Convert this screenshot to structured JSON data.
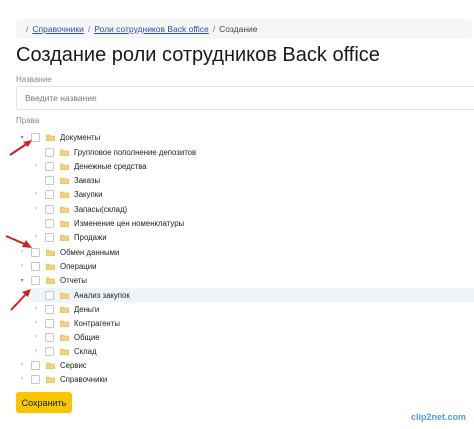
{
  "breadcrumb": {
    "items": [
      "Справочники",
      "Роли сотрудников Back office"
    ],
    "current": "Создание"
  },
  "page": {
    "title": "Создание роли сотрудников Back office"
  },
  "form": {
    "name_label": "Название",
    "name_placeholder": "Введите название",
    "name_value": "",
    "rights_label": "Права"
  },
  "tree": [
    {
      "label": "Документы",
      "arrow": "expanded"
    },
    {
      "label": "Групповое пополнение депозитов",
      "arrow": "none"
    },
    {
      "label": "Денежные средства",
      "arrow": "collapsed"
    },
    {
      "label": "Заказы",
      "arrow": "none"
    },
    {
      "label": "Закупки",
      "arrow": "collapsed"
    },
    {
      "label": "Запасы(склад)",
      "arrow": "collapsed"
    },
    {
      "label": "Изменение цен номенклатуры",
      "arrow": "none"
    },
    {
      "label": "Продажи",
      "arrow": "collapsed"
    },
    {
      "label": "Обмен данными",
      "arrow": "collapsed"
    },
    {
      "label": "Операции",
      "arrow": "collapsed"
    },
    {
      "label": "Отчеты",
      "arrow": "expanded"
    },
    {
      "label": "Анализ закупок",
      "arrow": "none"
    },
    {
      "label": "Деньги",
      "arrow": "collapsed"
    },
    {
      "label": "Контрагенты",
      "arrow": "collapsed"
    },
    {
      "label": "Общие",
      "arrow": "collapsed"
    },
    {
      "label": "Склад",
      "arrow": "collapsed"
    },
    {
      "label": "Сервис",
      "arrow": "collapsed"
    },
    {
      "label": "Справочники",
      "arrow": "collapsed"
    }
  ],
  "actions": {
    "save_label": "Сохранить"
  },
  "watermark": "clip2net.com",
  "colors": {
    "accent": "#f7c600",
    "link": "#2b4fa8",
    "folder": "#f2d27a",
    "annotation_arrow": "#d91c1c",
    "row_highlight": "#eef4fa"
  }
}
